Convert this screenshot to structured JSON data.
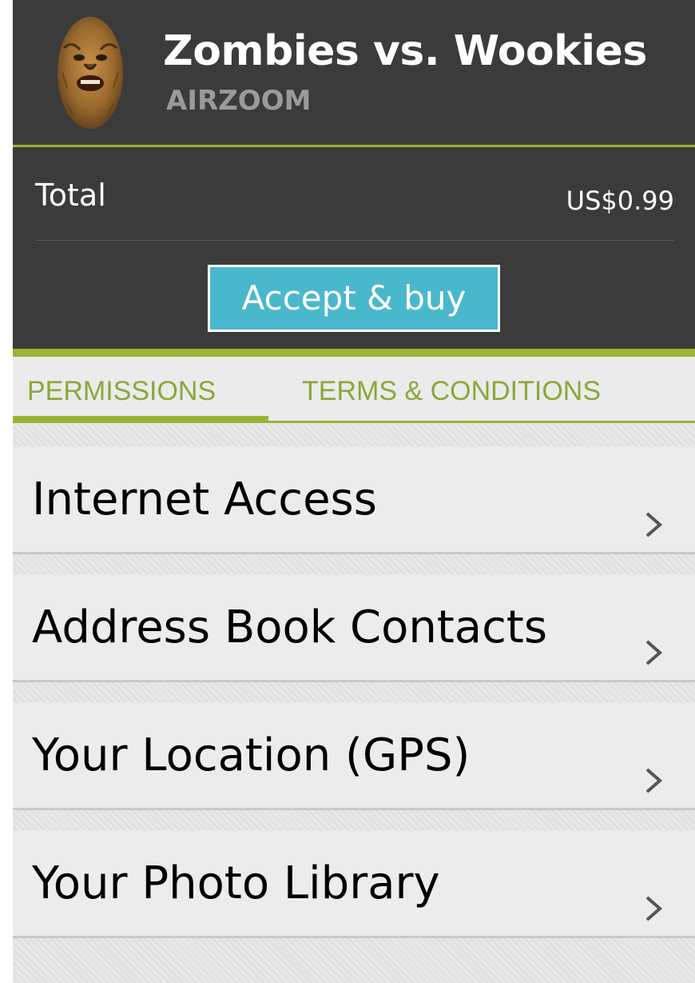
{
  "app": {
    "title": "Zombies vs. Wookies",
    "developer": "AIRZOOM",
    "icon": "wookiee-face-icon"
  },
  "purchase": {
    "total_label": "Total",
    "total_value": "US$0.99",
    "buy_label": "Accept & buy"
  },
  "tabs": [
    {
      "label": "PERMISSIONS",
      "active": true
    },
    {
      "label": "TERMS & CONDITIONS",
      "active": false
    }
  ],
  "permissions": [
    {
      "label": "Internet Access"
    },
    {
      "label": "Address Book Contacts"
    },
    {
      "label": "Your Location (GPS)"
    },
    {
      "label": "Your Photo Library"
    }
  ],
  "colors": {
    "header_bg": "#3b3b3b",
    "accent_green": "#99b433",
    "button_blue": "#4ab8cc",
    "tab_text": "#8aa83a",
    "list_bg": "#ececec"
  },
  "icons": {
    "row_chevron": "chevron-right-icon"
  }
}
